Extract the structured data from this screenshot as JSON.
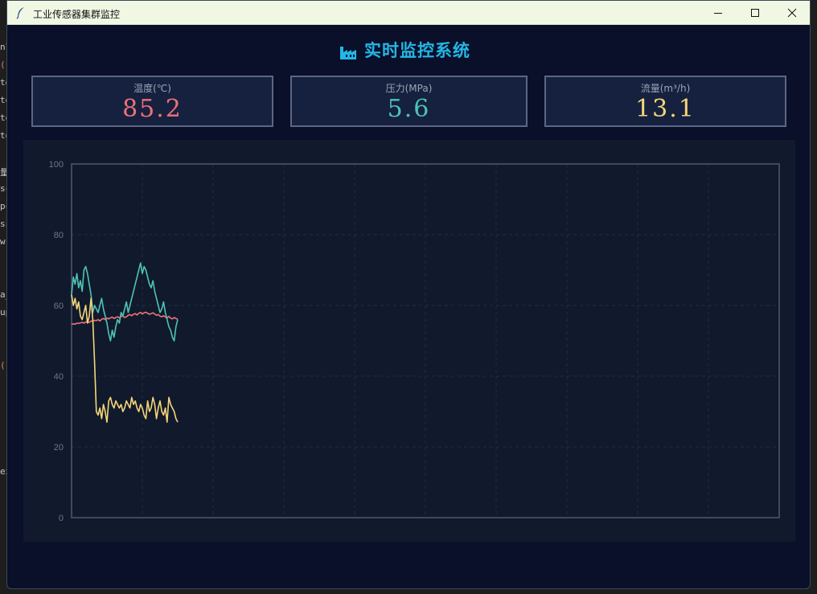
{
  "window": {
    "title": "工业传感器集群监控",
    "controls": {
      "minimize": "minimize-icon",
      "maximize": "maximize-icon",
      "close": "close-icon"
    }
  },
  "header": {
    "icon": "factory-icon",
    "title": "实时监控系统"
  },
  "cards": [
    {
      "label": "温度(℃)",
      "value": "85.2",
      "color": "#f0707a"
    },
    {
      "label": "压力(MPa)",
      "value": "5.6",
      "color": "#4ec3b7"
    },
    {
      "label": "流量(m³/h)",
      "value": "13.1",
      "color": "#f5d677"
    }
  ],
  "chart_data": {
    "type": "line",
    "ylim": [
      0,
      100
    ],
    "yticks": [
      "0",
      "20",
      "40",
      "60",
      "80",
      "100"
    ],
    "xlim": [
      0,
      100
    ],
    "grid": true,
    "series": [
      {
        "color": "#f0707a",
        "values": [
          54.6,
          54.8,
          54.7,
          55.0,
          54.9,
          55.1,
          55.2,
          55.0,
          55.3,
          55.4,
          55.2,
          55.6,
          55.5,
          55.8,
          55.7,
          56.0,
          55.6,
          56.1,
          56.3,
          56.0,
          56.4,
          56.2,
          56.5,
          56.7,
          56.3,
          56.6,
          56.8,
          56.5,
          56.9,
          57.0,
          56.6,
          56.8,
          57.2,
          57.4,
          57.1,
          57.5,
          57.7,
          57.3,
          57.8,
          58.0,
          57.6,
          57.9,
          58.1,
          57.8,
          57.5,
          57.7,
          57.9,
          57.6,
          57.2,
          57.4,
          57.0,
          56.8,
          57.1,
          56.7,
          56.5,
          56.9,
          56.4,
          56.2,
          56.6,
          56.3,
          56.1
        ]
      },
      {
        "color": "#4ec3b7",
        "values": [
          63,
          68,
          66,
          69,
          65,
          67,
          64,
          70,
          71,
          69,
          66,
          63,
          58,
          60,
          59,
          58,
          60,
          62,
          59,
          57,
          55,
          52,
          50,
          53,
          51,
          54,
          56,
          55,
          58,
          57,
          59,
          61,
          58,
          60,
          62,
          64,
          66,
          68,
          70,
          72,
          69,
          71,
          70,
          68,
          66,
          65,
          67,
          64,
          62,
          60,
          58,
          59,
          61,
          58,
          56,
          54,
          53,
          51,
          50,
          54,
          56
        ]
      },
      {
        "color": "#f5d677",
        "values": [
          63,
          60,
          62,
          59,
          61,
          57,
          56,
          58,
          60,
          55,
          57,
          62,
          56,
          44,
          30,
          29,
          31,
          28,
          32,
          30,
          27,
          33,
          34,
          32,
          31,
          33,
          32,
          31,
          32,
          30,
          31,
          33,
          32,
          31,
          34,
          32,
          33,
          31,
          30,
          32,
          31,
          29,
          28,
          33,
          30,
          31,
          34,
          32,
          28,
          31,
          33,
          30,
          29,
          31,
          27,
          34,
          32,
          31,
          30,
          28,
          27
        ]
      }
    ]
  }
}
